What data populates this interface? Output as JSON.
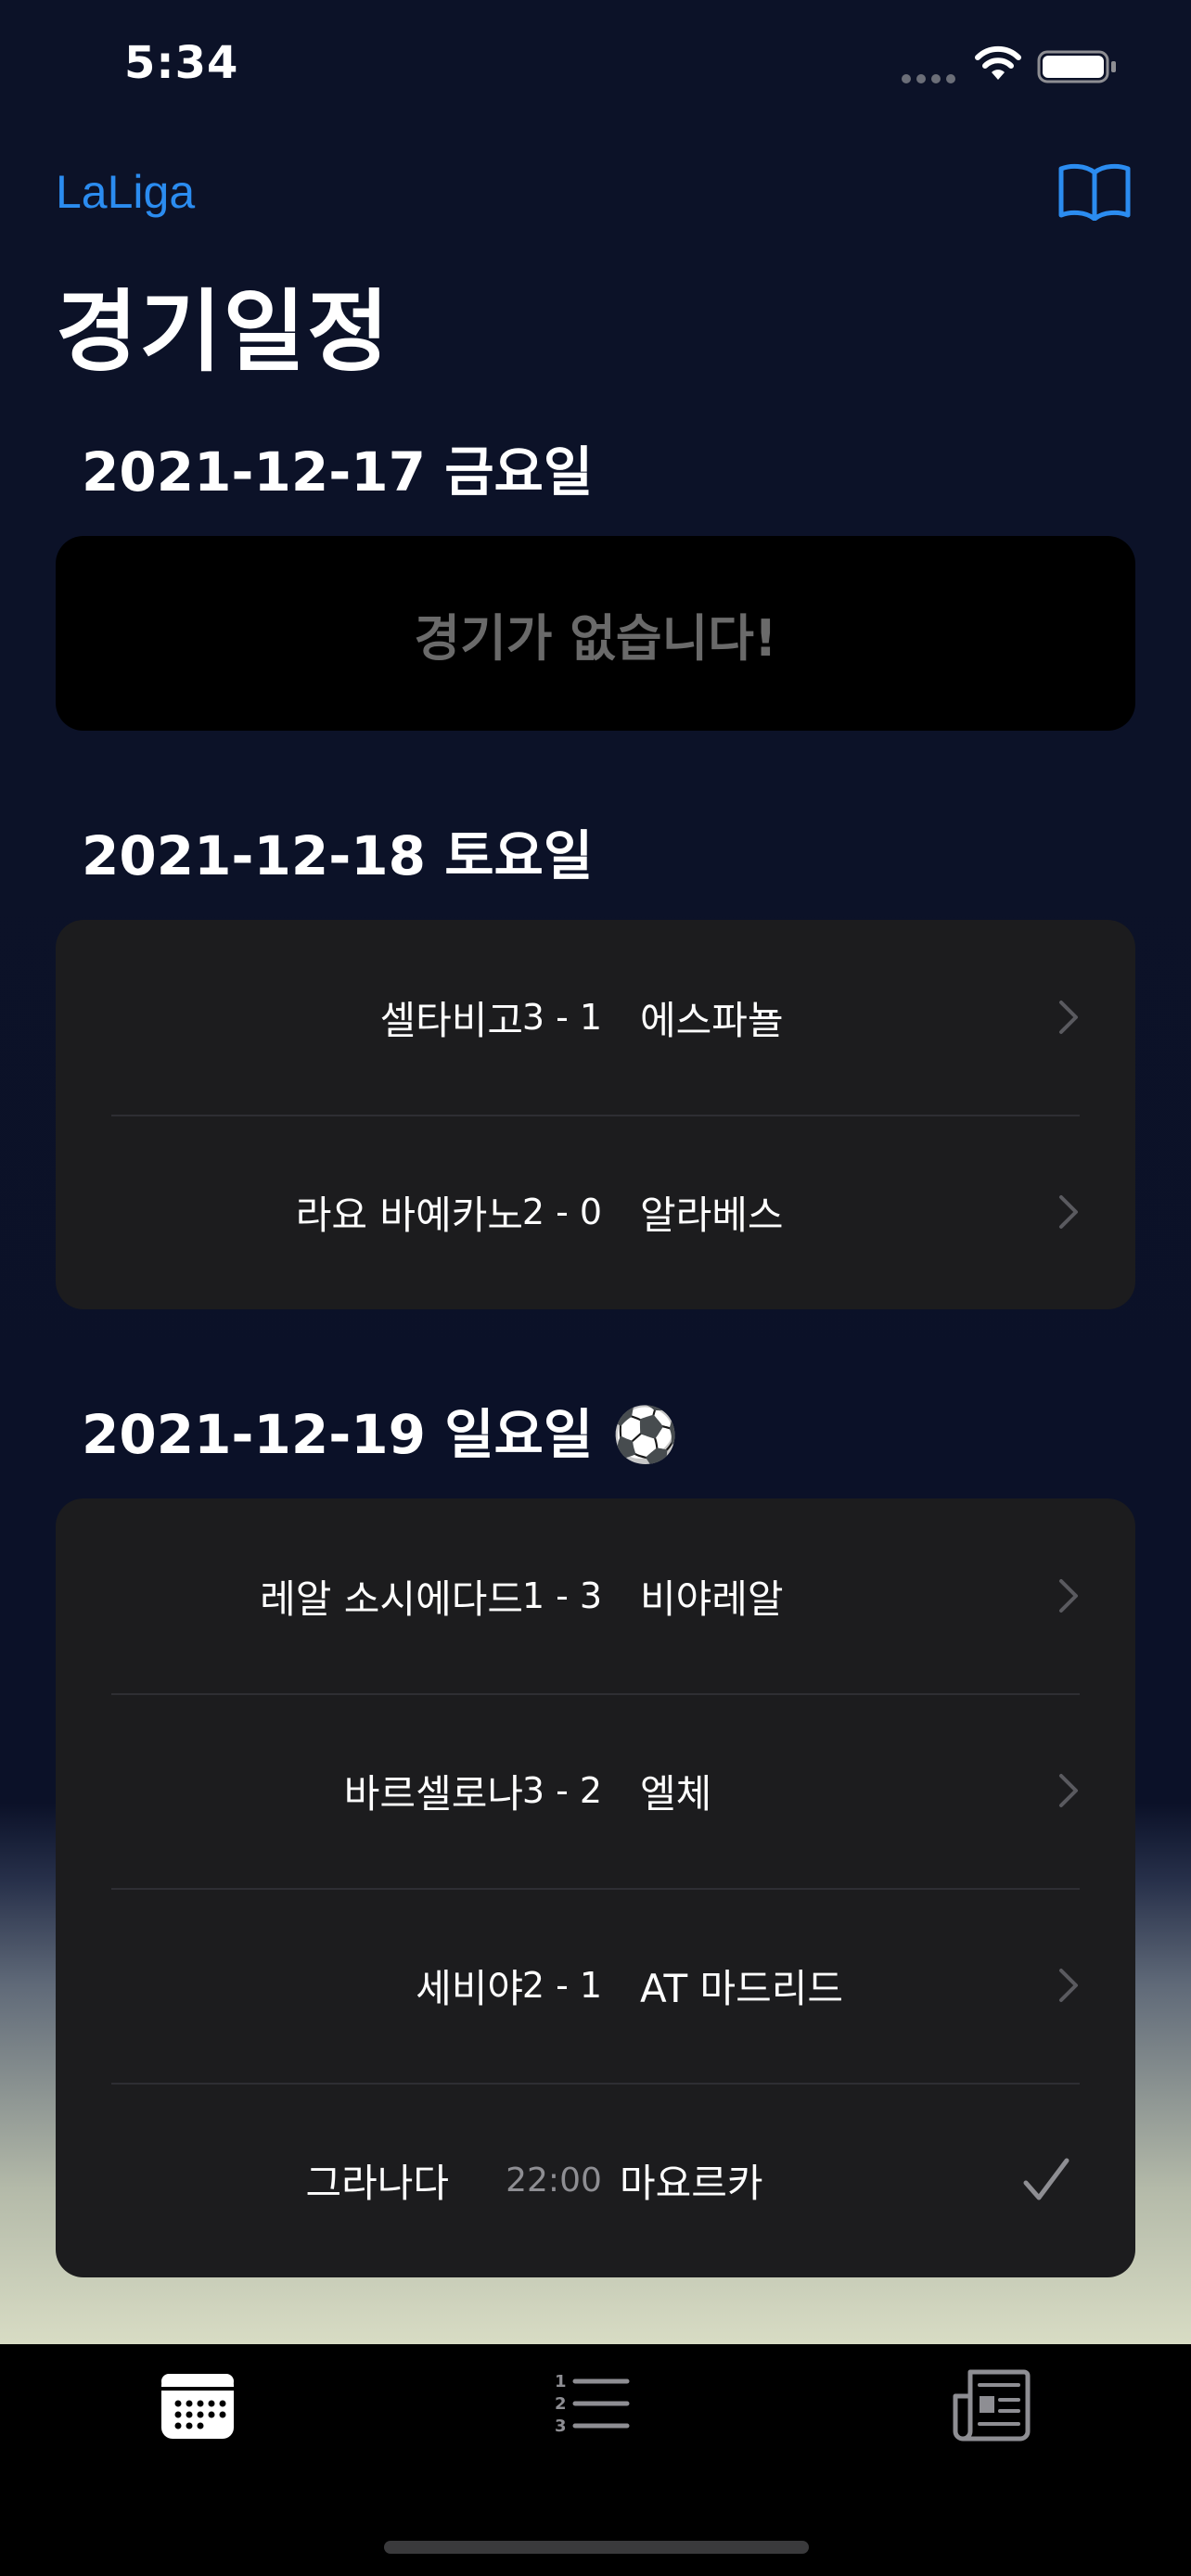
{
  "status_bar": {
    "time": "5:34"
  },
  "nav": {
    "back_label": "LaLiga",
    "title": "경기일정"
  },
  "sections": [
    {
      "date": "2021-12-17 금요일",
      "empty_text": "경기가 없습니다!"
    },
    {
      "date": "2021-12-18 토요일",
      "matches": [
        {
          "home": "셀타비고",
          "score": "3 - 1",
          "away": "에스파뇰"
        },
        {
          "home": "라요 바예카노",
          "score": "2 - 0",
          "away": "알라베스"
        }
      ]
    },
    {
      "date": "2021-12-19 일요일 ⚽️",
      "matches": [
        {
          "home": "레알 소시에다드",
          "score": "1 - 3",
          "away": "비야레알"
        },
        {
          "home": "바르셀로나",
          "score": "3 - 2",
          "away": "엘체"
        },
        {
          "home": "세비야",
          "score": "2 - 1",
          "away": "AT 마드리드"
        },
        {
          "home": "그라나다",
          "score": "22:00",
          "away": "마요르카"
        }
      ]
    }
  ],
  "colors": {
    "accent": "#2b8cf0",
    "card": "#1c1c1e",
    "background": "#0c1228"
  },
  "icons": {
    "nav_right": "book-icon",
    "row_disclosure": "chevron-right-icon",
    "row_selected": "checkmark-icon",
    "tabs": [
      "calendar-icon",
      "numbered-list-icon",
      "newspaper-icon"
    ]
  },
  "tab_bar": {
    "selected_index": 0
  }
}
